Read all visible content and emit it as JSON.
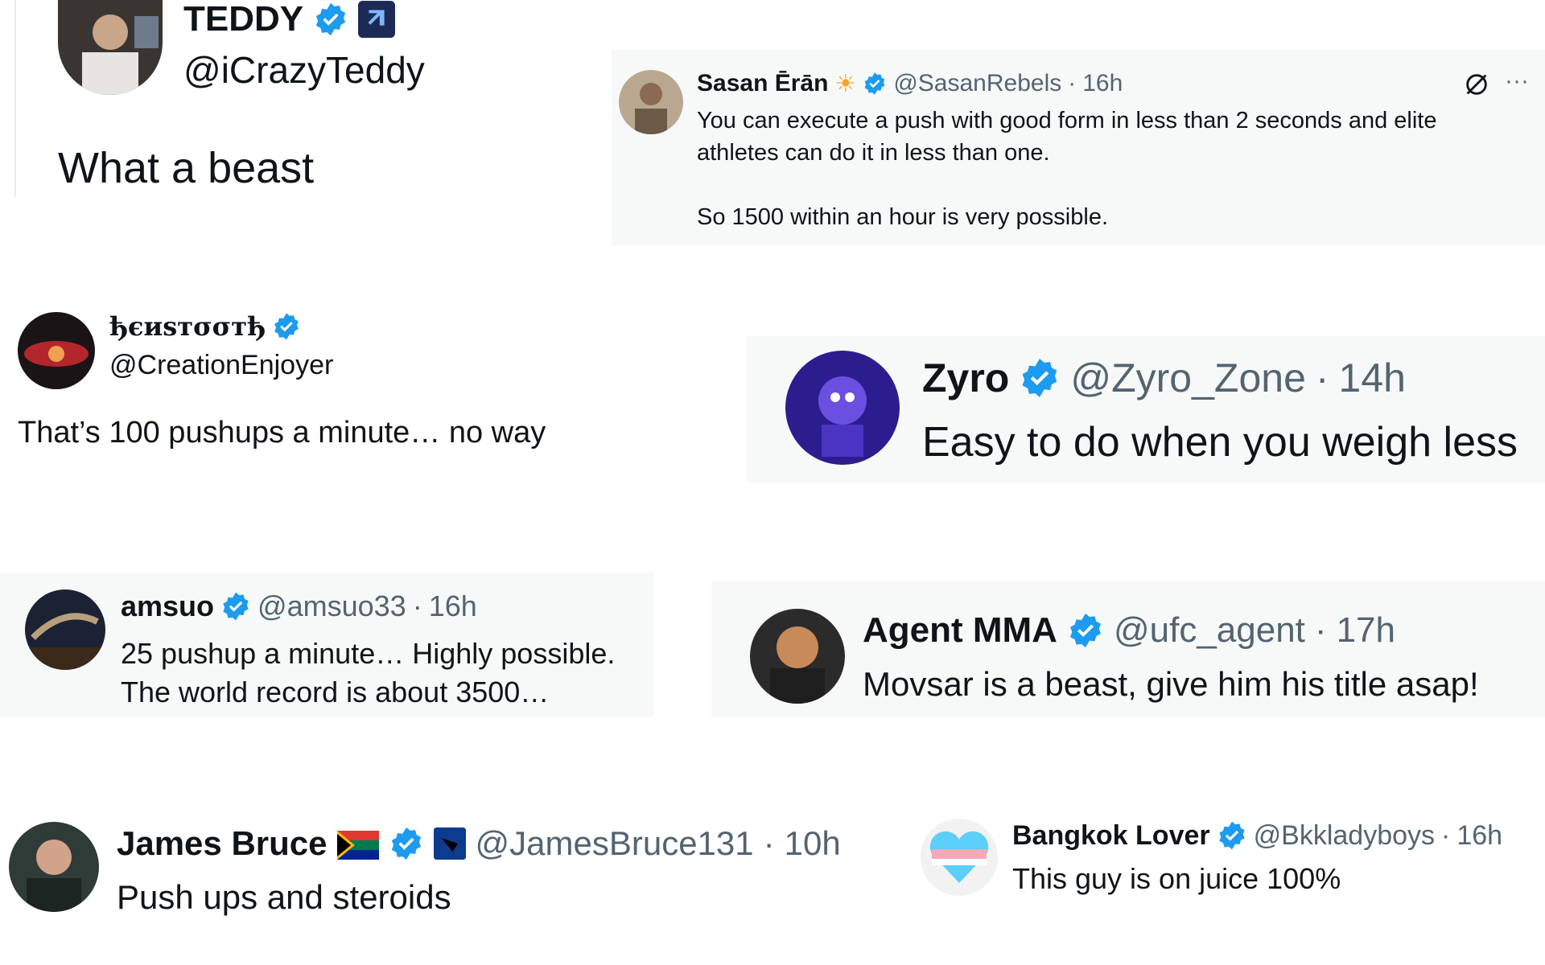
{
  "tweets": [
    {
      "name": "TEDDY",
      "handle": "@iCrazyTeddy",
      "time": "",
      "text": "What a beast"
    },
    {
      "name": "Sasan Ērān",
      "handle": "@SasanRebels",
      "time": "16h",
      "text": "You can execute a push with good form in less than 2 seconds and elite",
      "text2": "athletes can do it in less than one.",
      "text3": "So 1500 within an hour is very possible."
    },
    {
      "name": "ђєиѕтσσтђ",
      "handle": "@CreationEnjoyer",
      "time": "",
      "text": "That’s 100 pushups a minute… no way"
    },
    {
      "name": "Zyro",
      "handle": "@Zyro_Zone",
      "time": "14h",
      "text": "Easy to do when you weigh less"
    },
    {
      "name": "amsuo",
      "handle": "@amsuo33",
      "time": "16h",
      "text": "25 pushup a minute… Highly possible.",
      "text2": "The world record is about 3500…"
    },
    {
      "name": "Agent MMA",
      "handle": "@ufc_agent",
      "time": "17h",
      "text": "Movsar is a beast, give him his title asap!"
    },
    {
      "name": "James Bruce",
      "handle": "@JamesBruce131",
      "time": "10h",
      "text": "Push ups and steroids"
    },
    {
      "name": "Bangkok Lover",
      "handle": "@Bkkladyboys",
      "time": "16h",
      "text": "This guy is on juice 100%"
    }
  ],
  "sep": "·",
  "more": "···",
  "icons": {
    "verified": "verified-badge-icon",
    "grok": "grok-icon",
    "more": "more-icon"
  },
  "colors": {
    "verified": "#1d9bf0",
    "text": "#0f1419",
    "muted": "#536471",
    "card": "#f7f9f9"
  }
}
